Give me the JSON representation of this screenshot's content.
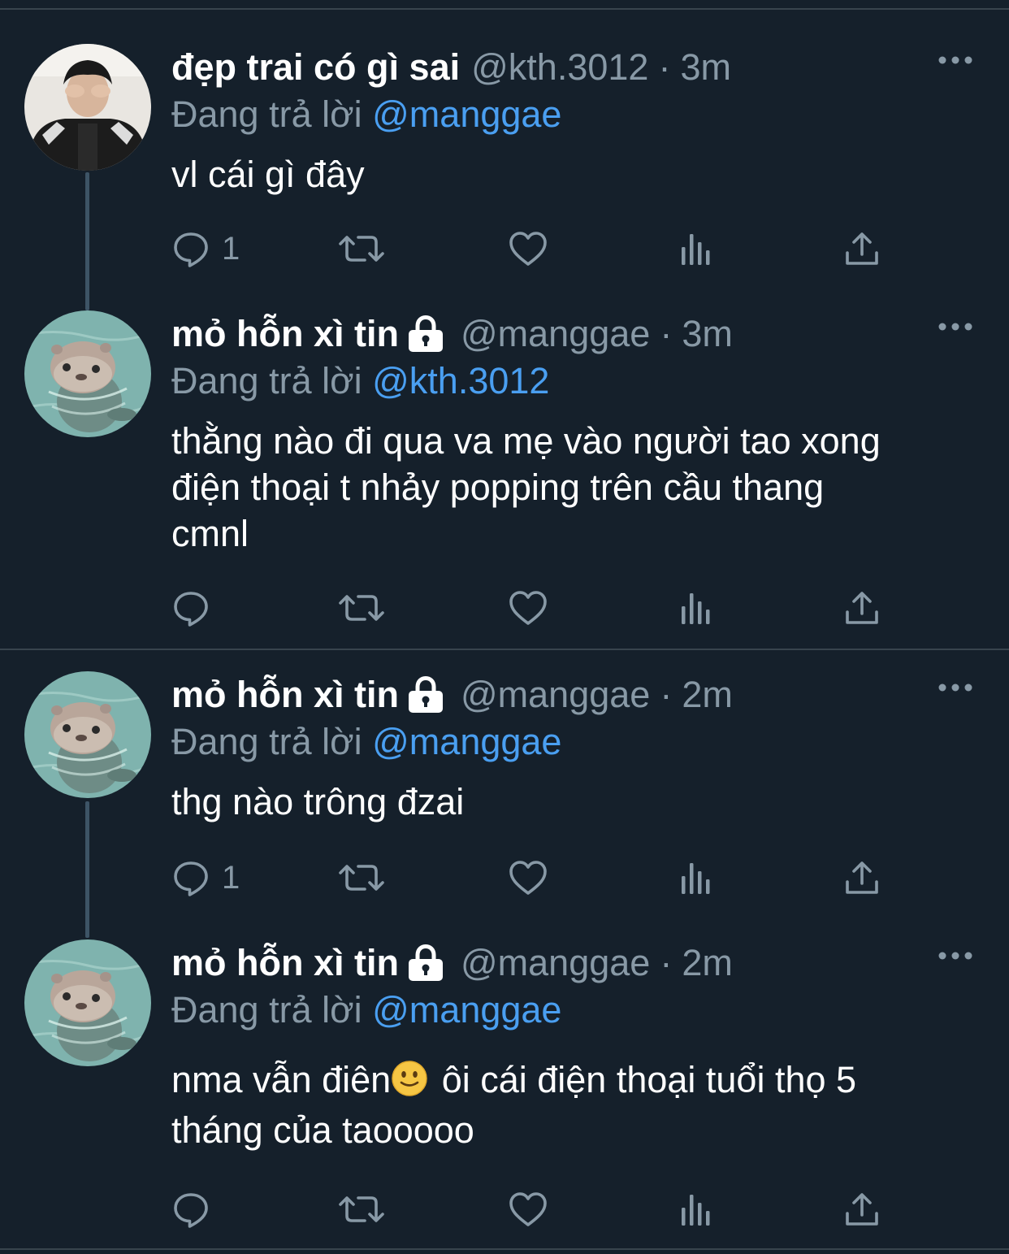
{
  "tweets": [
    {
      "display_name": "đẹp trai có gì sai",
      "handle": "@kth.3012",
      "separator": "·",
      "time": "3m",
      "reply_prefix": "Đang trả lời",
      "reply_to": "@manggae",
      "text": "vl cái gì đây",
      "reply_count": "1",
      "avatar": "person-photo-avatar",
      "locked": false
    },
    {
      "display_name": "mỏ hỗn xì tin",
      "handle": "@manggae",
      "separator": "·",
      "time": "3m",
      "reply_prefix": "Đang trả lời",
      "reply_to": "@kth.3012",
      "text_lines": [
        "thằng nào đi qua va mẹ vào người tao xong",
        "điện thoại t nhảy popping trên cầu thang",
        "cmnl"
      ],
      "reply_count": "",
      "avatar": "otter-avatar",
      "locked": true
    },
    {
      "display_name": "mỏ hỗn xì tin",
      "handle": "@manggae",
      "separator": "·",
      "time": "2m",
      "reply_prefix": "Đang trả lời",
      "reply_to": "@manggae",
      "text": "thg nào trông đzai",
      "reply_count": "1",
      "avatar": "otter-avatar",
      "locked": true
    },
    {
      "display_name": "mỏ hỗn xì tin",
      "handle": "@manggae",
      "separator": "·",
      "time": "2m",
      "reply_prefix": "Đang trả lời",
      "reply_to": "@manggae",
      "text_line1_before_emoji": "nma vẫn điên",
      "text_line1_after_emoji": " ôi cái điện thoại tuổi thọ 5",
      "text_line2": "tháng của taooooo",
      "emoji": "slightly-smiling-face",
      "reply_count": "",
      "avatar": "otter-avatar",
      "locked": true
    }
  ],
  "icons": {
    "reply": "reply-icon",
    "retweet": "retweet-icon",
    "like": "like-icon",
    "analytics": "analytics-icon",
    "share": "share-icon",
    "more": "more-icon",
    "lock": "lock-icon"
  },
  "colors": {
    "background": "#15202b",
    "text": "#ffffff",
    "secondary": "#8899a6",
    "link": "#4a9ff1",
    "divider": "#38444d"
  }
}
